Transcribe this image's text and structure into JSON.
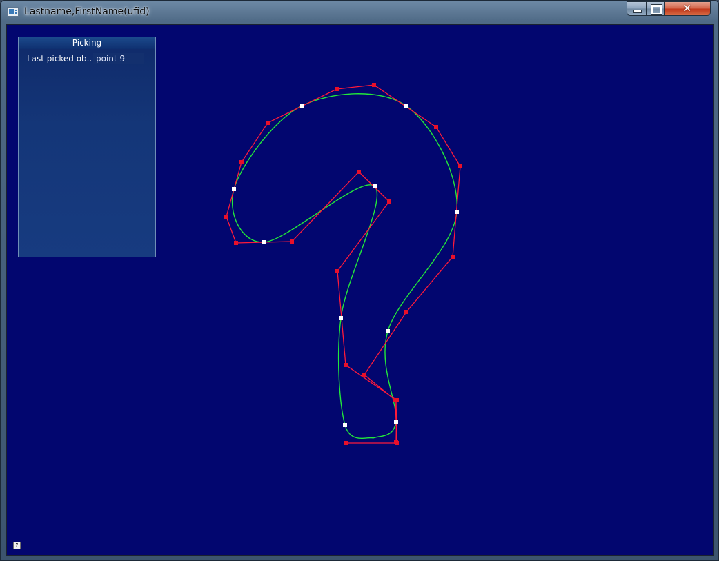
{
  "window": {
    "title": "Lastname,FirstName(ufid)",
    "close_glyph": "✕"
  },
  "picking_panel": {
    "title": "Picking",
    "last_picked_label": "Last picked ob..",
    "last_picked_value": "point 9"
  },
  "help_icon": "?",
  "colors": {
    "background": "#02066f",
    "control_polygon": "#ff1a3a",
    "control_point": "#e8102a",
    "curve": "#22e83a",
    "junction_point": "#ffffff"
  }
}
